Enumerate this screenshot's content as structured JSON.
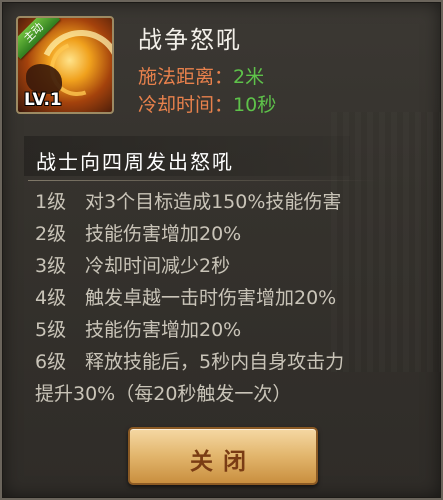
{
  "skill": {
    "badge": "主动",
    "level_label": "LV.1",
    "name": "战争怒吼",
    "stats": [
      {
        "label": "施法距离：",
        "value": "2米"
      },
      {
        "label": "冷却时间：",
        "value": "10秒"
      }
    ],
    "description": "战士向四周发出怒吼"
  },
  "levels": [
    {
      "tag": "1级",
      "text": "对3个目标造成150%技能伤害"
    },
    {
      "tag": "2级",
      "text": "技能伤害增加20%"
    },
    {
      "tag": "3级",
      "text": "冷却时间减少2秒"
    },
    {
      "tag": "4级",
      "text": "触发卓越一击时伤害增加20%"
    },
    {
      "tag": "5级",
      "text": "技能伤害增加20%"
    },
    {
      "tag": "6级",
      "text": "释放技能后，5秒内自身攻击力"
    },
    {
      "tag": "",
      "text": "提升30%（每20秒触发一次）"
    }
  ],
  "buttons": {
    "close_label": "关闭"
  },
  "colors": {
    "stat_label": "#e8814c",
    "stat_value": "#5ec24a",
    "badge": "#3f9a2a",
    "button": "#e2b56c"
  }
}
